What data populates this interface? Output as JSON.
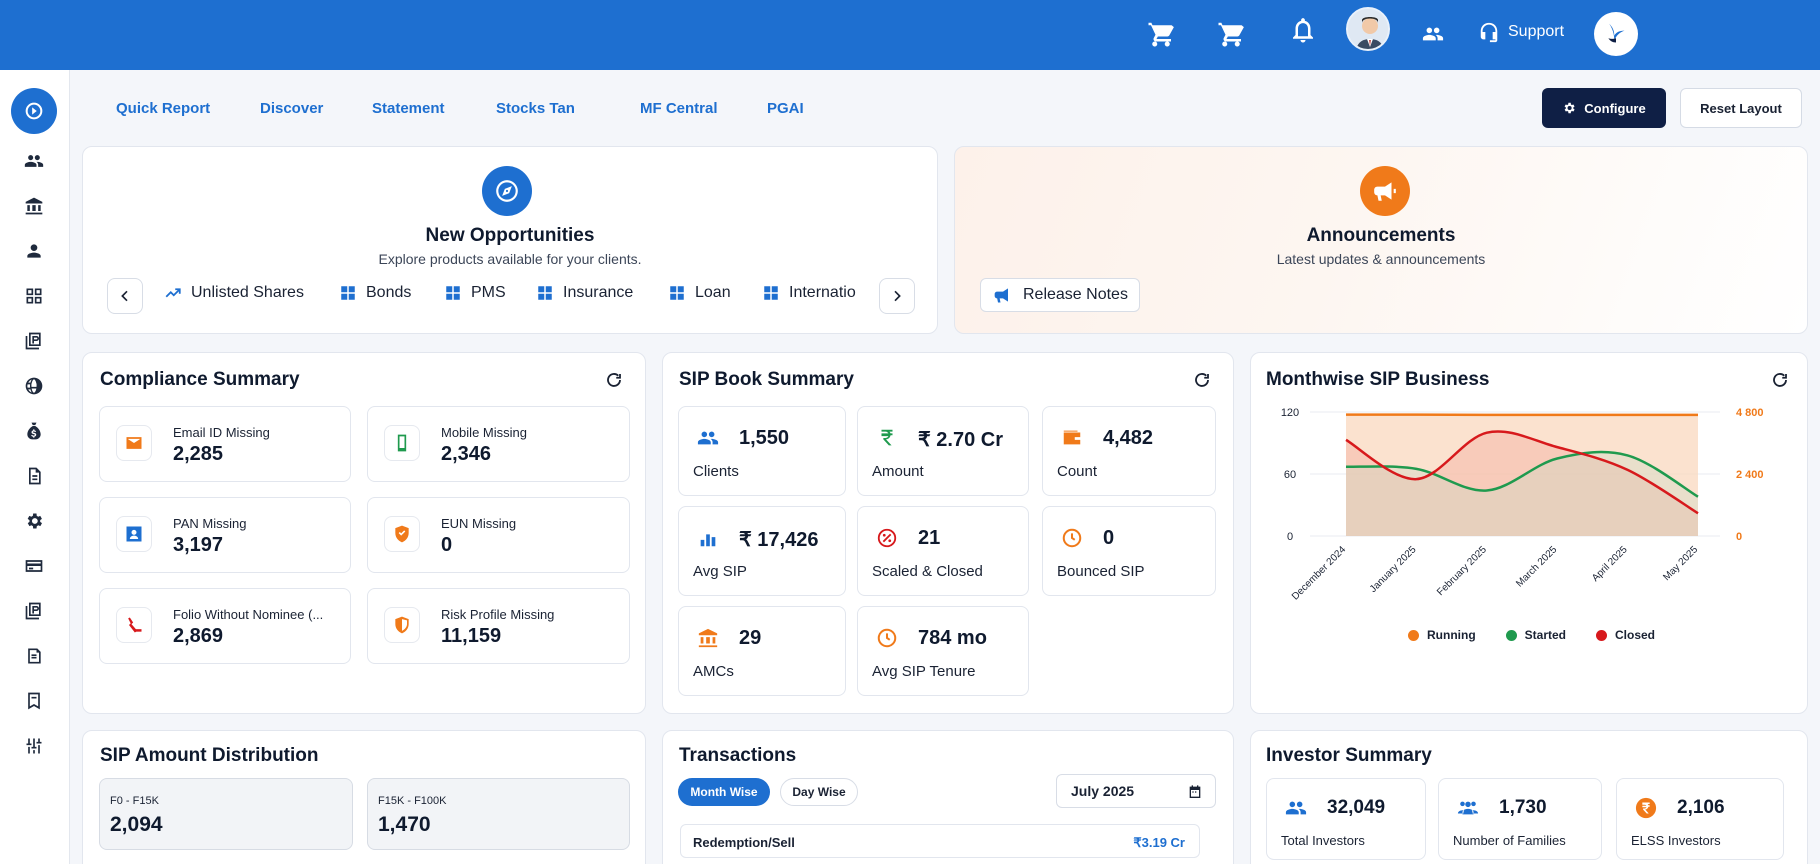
{
  "topbar": {
    "support_label": "Support"
  },
  "nav": {
    "tabs": [
      "Quick Report",
      "Discover",
      "Statement",
      "Stocks Tan",
      "MF Central",
      "PGAI"
    ],
    "configure_label": "Configure",
    "reset_label": "Reset Layout"
  },
  "opportunities": {
    "title": "New Opportunities",
    "subtitle": "Explore products available for your clients.",
    "chips": [
      "Unlisted Shares",
      "Bonds",
      "PMS",
      "Insurance",
      "Loan",
      "Internatio"
    ]
  },
  "announcements": {
    "title": "Announcements",
    "subtitle": "Latest updates & announcements",
    "release_notes": "Release Notes"
  },
  "compliance": {
    "title": "Compliance Summary",
    "items": [
      {
        "label": "Email ID Missing",
        "value": "2,285",
        "icon": "mail-icon"
      },
      {
        "label": "Mobile Missing",
        "value": "2,346",
        "icon": "mobile-icon"
      },
      {
        "label": "PAN Missing",
        "value": "3,197",
        "icon": "id-card-icon"
      },
      {
        "label": "EUN Missing",
        "value": "0",
        "icon": "shield-icon"
      },
      {
        "label": "Folio Without Nominee (...",
        "value": "2,869",
        "icon": "nominee-icon"
      },
      {
        "label": "Risk Profile Missing",
        "value": "11,159",
        "icon": "shield-icon"
      }
    ]
  },
  "sip_book": {
    "title": "SIP Book Summary",
    "items": [
      {
        "value": "1,550",
        "label": "Clients",
        "icon": "users-icon"
      },
      {
        "value": "₹ 2.70 Cr",
        "label": "Amount",
        "icon": "rupee-icon"
      },
      {
        "value": "4,482",
        "label": "Count",
        "icon": "wallet-icon"
      },
      {
        "value": "₹ 17,426",
        "label": "Avg SIP",
        "icon": "bar-chart-icon"
      },
      {
        "value": "21",
        "label": "Scaled & Closed",
        "icon": "percent-icon"
      },
      {
        "value": "0",
        "label": "Bounced SIP",
        "icon": "clock-icon"
      },
      {
        "value": "29",
        "label": "AMCs",
        "icon": "bank-icon"
      },
      {
        "value": "784 mo",
        "label": "Avg SIP Tenure",
        "icon": "clock-icon"
      }
    ]
  },
  "monthwise": {
    "title": "Monthwise SIP Business"
  },
  "chart_data": {
    "type": "area",
    "title": "Monthwise SIP Business",
    "categories": [
      "December 2024",
      "January 2025",
      "February 2025",
      "March 2025",
      "April 2025",
      "May 2025"
    ],
    "left_axis": {
      "ticks": [
        "120",
        "60",
        "0"
      ],
      "range": [
        0,
        120
      ]
    },
    "right_axis": {
      "ticks": [
        "4 800",
        "2 400",
        "0"
      ],
      "range": [
        0,
        4800
      ],
      "color": "#f07a1a"
    },
    "series": [
      {
        "name": "Running",
        "axis": "right",
        "color": "#f07a1a",
        "values": [
          4700,
          4700,
          4690,
          4690,
          4690,
          4690
        ]
      },
      {
        "name": "Started",
        "axis": "left",
        "color": "#1f9a4e",
        "values": [
          67,
          65,
          44,
          75,
          78,
          38
        ]
      },
      {
        "name": "Closed",
        "axis": "left",
        "color": "#d7191c",
        "values": [
          93,
          55,
          100,
          86,
          64,
          22
        ]
      }
    ],
    "legend_position": "bottom"
  },
  "sip_distribution": {
    "title": "SIP Amount Distribution",
    "items": [
      {
        "label": "F0 - F15K",
        "value": "2,094"
      },
      {
        "label": "F15K - F100K",
        "value": "1,470"
      }
    ]
  },
  "transactions": {
    "title": "Transactions",
    "month_wise": "Month Wise",
    "day_wise": "Day Wise",
    "date": "July 2025",
    "row_label": "Redemption/Sell",
    "row_value": "₹3.19 Cr"
  },
  "investor_summary": {
    "title": "Investor Summary",
    "items": [
      {
        "value": "32,049",
        "label": "Total Investors",
        "icon": "user-icon"
      },
      {
        "value": "1,730",
        "label": "Number of Families",
        "icon": "family-icon"
      },
      {
        "value": "2,106",
        "label": "ELSS Investors",
        "icon": "rupee-icon"
      }
    ]
  },
  "colors": {
    "primary": "#1e6fd0",
    "dark_navy": "#0f1f45",
    "accent_orange": "#f07a1a"
  }
}
